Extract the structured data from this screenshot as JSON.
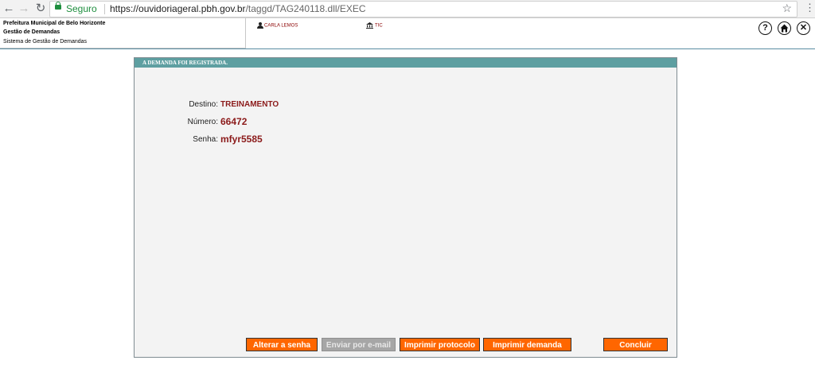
{
  "browser": {
    "secure_label": "Seguro",
    "url_host": "https://ouvidoriageral.pbh.gov.br",
    "url_path": "/taggd/TAG240118.dll/EXEC"
  },
  "header": {
    "org_name": "Prefeitura Municipal de Belo Horizonte",
    "module_name": "Gestão de Demandas",
    "system_name": "Sistema de Gestão de Demandas",
    "user_name": "CARLA LEMOS",
    "unit_name": "TIC",
    "help_label": "?",
    "close_label": "✕"
  },
  "panel": {
    "title": "A DEMANDA FOI REGISTRADA.",
    "fields": [
      {
        "label": "Destino:",
        "value": "TREINAMENTO"
      },
      {
        "label": "Número:",
        "value": "66472"
      },
      {
        "label": "Senha:",
        "value": "mfyr5585"
      }
    ]
  },
  "actions": {
    "alterar_senha": "Alterar a senha",
    "enviar_email": "Enviar por e-mail",
    "imprimir_protocolo": "Imprimir protocolo",
    "imprimir_demanda": "Imprimir demanda",
    "concluir": "Concluir"
  },
  "colors": {
    "accent": "#ff6600",
    "title_bar": "#5e9fa1",
    "value_text": "#8b1a1a"
  }
}
